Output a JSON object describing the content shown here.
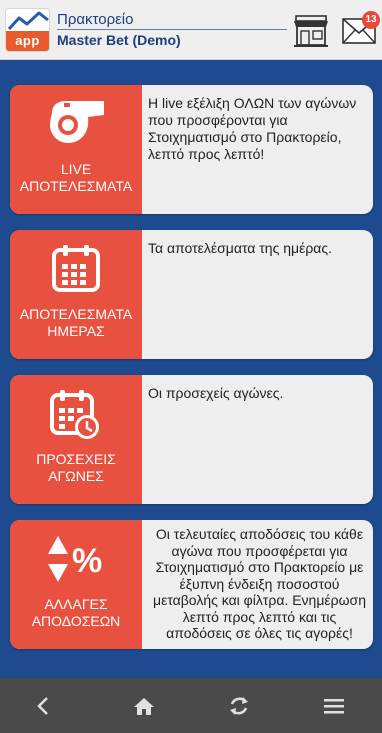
{
  "header": {
    "app_logo_text": "app",
    "title": "Πρακτορείο",
    "subtitle": "Master Bet (Demo)",
    "notification_count": "13"
  },
  "cards": [
    {
      "icon": "whistle-icon",
      "label_line1": "LIVE",
      "label_line2": "ΑΠΟΤΕΛΕΣΜΑΤΑ",
      "description": "Η live εξέλιξη ΟΛΩΝ των αγώνων που προσφέρονται για Στοιχηματισμό στο Πρακτορείο, λεπτό προς λεπτό!"
    },
    {
      "icon": "calendar-icon",
      "label_line1": "ΑΠΟΤΕΛΕΣΜΑΤΑ",
      "label_line2": "ΗΜΕΡΑΣ",
      "description": "Τα αποτελέσματα της ημέρας."
    },
    {
      "icon": "calendar-clock-icon",
      "label_line1": "ΠΡΟΣΕΧΕΙΣ",
      "label_line2": "ΑΓΩΝΕΣ",
      "description": "Οι προσεχείς αγώνες."
    },
    {
      "icon": "odds-change-icon",
      "label_line1": "ΑΛΛΑΓΕΣ",
      "label_line2": "ΑΠΟΔΟΣΕΩΝ",
      "description": "Οι τελευταίες αποδόσεις του κάθε αγώνα που προσφέρεται για Στοιχηματισμό στο Πρακτορείο με έξυπνη ένδειξη ποσοστού μεταβολής και φίλτρα. Ενημέρωση λεπτό προς λεπτό και τις αποδόσεις σε όλες τις αγορές!"
    }
  ],
  "bottom_nav": [
    "back-icon",
    "home-icon",
    "refresh-icon",
    "menu-icon"
  ],
  "colors": {
    "background": "#1e4a8f",
    "card_accent": "#e8513f",
    "header_bg": "#efefef",
    "nav_bg": "#4a4a4a"
  }
}
